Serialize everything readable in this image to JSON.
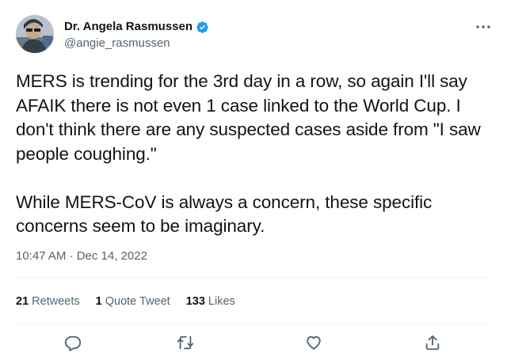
{
  "author": {
    "name": "Dr. Angela Rasmussen",
    "handle": "@angie_rasmussen",
    "verified": true
  },
  "tweet": {
    "paragraphs": [
      "MERS is trending for the 3rd day in a row, so again I'll say AFAIK there is not even 1 case linked to the World Cup. I don't think there are any suspected cases aside from \"I saw people coughing.\"",
      "While MERS-CoV is always a concern, these specific concerns seem to be imaginary."
    ],
    "timestamp": "10:47 AM · Dec 14, 2022"
  },
  "stats": {
    "retweets": {
      "count": "21",
      "label": "Retweets"
    },
    "quote_tweets": {
      "count": "1",
      "label": "Quote Tweet"
    },
    "likes": {
      "count": "133",
      "label": "Likes"
    }
  },
  "icons": {
    "more": "more-options-icon",
    "reply": "reply-icon",
    "retweet": "retweet-icon",
    "like": "like-icon",
    "share": "share-icon"
  },
  "colors": {
    "text": "#0f1419",
    "secondary": "#536471",
    "verified": "#1d9bf0",
    "divider": "#eff3f4"
  }
}
